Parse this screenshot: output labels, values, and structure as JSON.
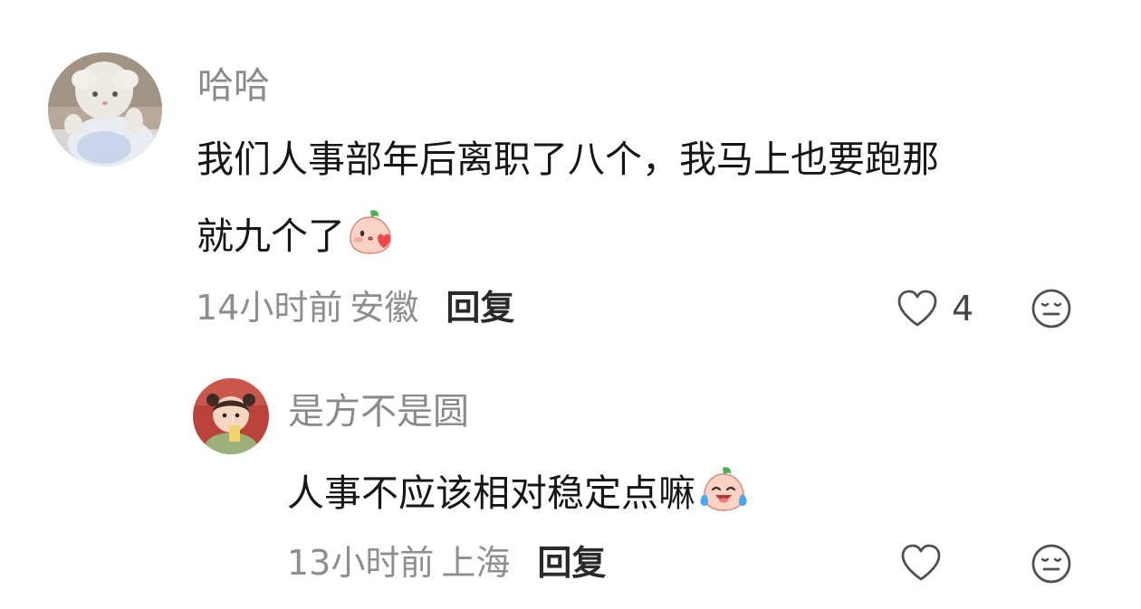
{
  "comments": [
    {
      "username": "哈哈",
      "text_lines": [
        "我们人事部年后离职了八个，我马上也要跑那",
        "就九个了"
      ],
      "emoji": "peach-kiss-emoji",
      "time": "14小时前",
      "location": "安徽",
      "reply_label": "回复",
      "like_count": "4",
      "avatar": "plush-doll-avatar"
    },
    {
      "username": "是方不是圆",
      "text_lines": [
        "人事不应该相对稳定点嘛"
      ],
      "emoji": "peach-crying-laughing-emoji",
      "time": "13小时前",
      "location": "上海",
      "reply_label": "回复",
      "like_count": "",
      "avatar": "toddler-photo-avatar"
    }
  ],
  "icons": {
    "like": "heart-outline-icon",
    "dislike": "meh-face-icon"
  },
  "colors": {
    "username": "#8a8a8a",
    "body_text": "#161616",
    "meta": "#8e8e8e",
    "reply": "#2a2a2a",
    "icon": "#505050"
  }
}
